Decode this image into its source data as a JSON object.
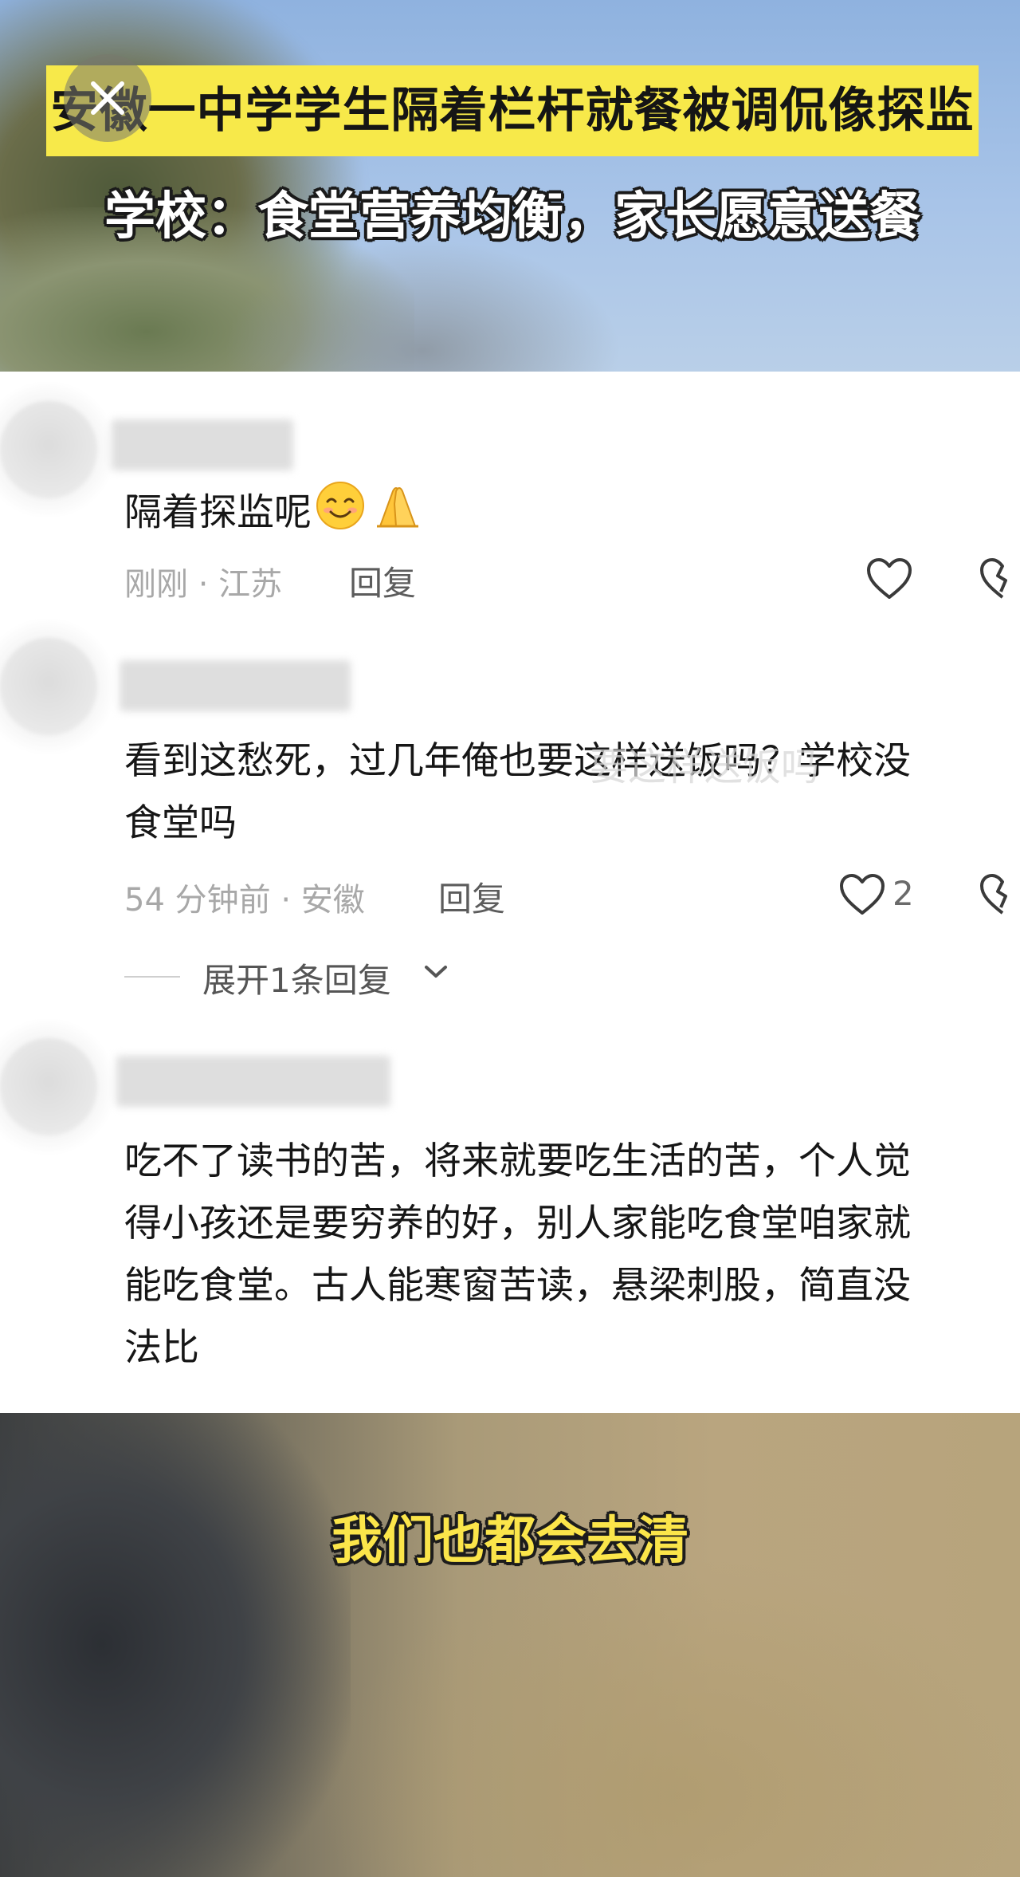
{
  "video_top": {
    "headline": "安徽一中学学生隔着栏杆就餐被调侃像探监",
    "subheadline": "学校：食堂营养均衡，家长愿意送餐",
    "close_icon": "close-icon"
  },
  "comments": [
    {
      "text_lines": [
        "隔着探监呢"
      ],
      "emojis": [
        "smiling-face-emoji",
        "folded-hands-emoji"
      ],
      "meta": "刚刚 · 江苏",
      "reply_label": "回复",
      "likes": ""
    },
    {
      "text_lines": [
        "看到这愁死，过几年俺也要这样送饭吗？学校没",
        "食堂吗"
      ],
      "meta": "54 分钟前 · 安徽",
      "reply_label": "回复",
      "likes": "2",
      "expand_label": "展开1条回复"
    },
    {
      "text_lines": [
        "吃不了读书的苦，将来就要吃生活的苦，个人觉",
        "得小孩还是要穷养的好，别人家能吃食堂咱家就",
        "能吃食堂。古人能寒窗苦读，悬梁刺股，简直没",
        "法比"
      ]
    }
  ],
  "overlay_watermark": "要这样送饭吗",
  "video_bottom": {
    "subtitle": "我们也都会去清"
  },
  "colors": {
    "headline_bg": "#f7e94a",
    "subtitle_yellow": "#fbe54a",
    "meta_gray": "#a8a8a8"
  }
}
